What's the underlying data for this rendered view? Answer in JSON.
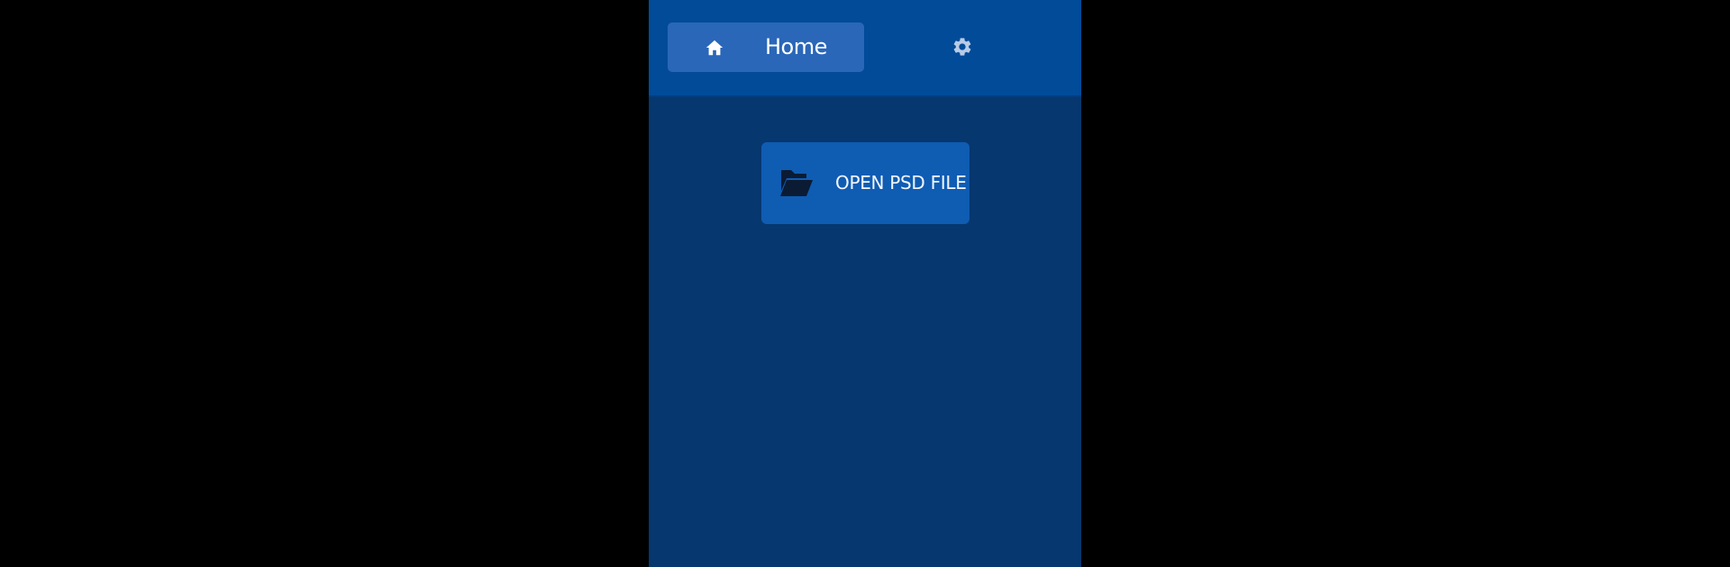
{
  "app": {
    "background_color": "#06376e",
    "topbar_color": "#014b99"
  },
  "nav": {
    "home_tab": {
      "label": "Home",
      "icon": "home-icon",
      "active": true
    },
    "settings": {
      "icon": "gear-icon"
    }
  },
  "main": {
    "open_button": {
      "label": "OPEN PSD FILE",
      "icon": "folder-open-icon"
    }
  }
}
